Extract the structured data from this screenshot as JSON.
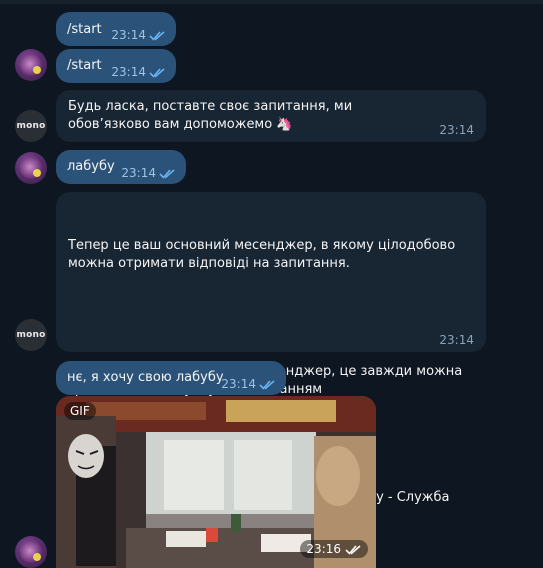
{
  "messages": [
    {
      "text": "/start",
      "time": "23:14"
    },
    {
      "text": "/start",
      "time": "23:14"
    },
    {
      "text": "Будь ласка, поставте своє запитання, ми обов’язково вам допоможемо 🦄",
      "time": "23:14"
    },
    {
      "text": "лабубу",
      "time": "23:14"
    },
    {
      "text_part1": "Тепер це ваш основний месенджер, в якому цілодобово можна отримати відповіді на запитання.",
      "text_part2": "Якщо ви захочете змінити месенджер, це завжди можна зробити в застосунку за посиланням",
      "link": "https://mbnk.app/more/support",
      "text_part3": "або на головному екрані - прокрутити донизу - Служба підтримки",
      "time": "23:14"
    },
    {
      "text": "нє, я хочу свою лабубу",
      "time": "23:14"
    },
    {
      "gif_label": "GIF",
      "time": "23:16"
    }
  ],
  "bot_avatar_label": "mono",
  "colors": {
    "background": "#0e1621",
    "incoming_bubble": "#182533",
    "outgoing_bubble": "#2b5278",
    "link": "#6ab3f3",
    "time_outgoing": "#9fc3e7"
  },
  "icons": [
    "double-check-icon",
    "unicorn-emoji"
  ]
}
